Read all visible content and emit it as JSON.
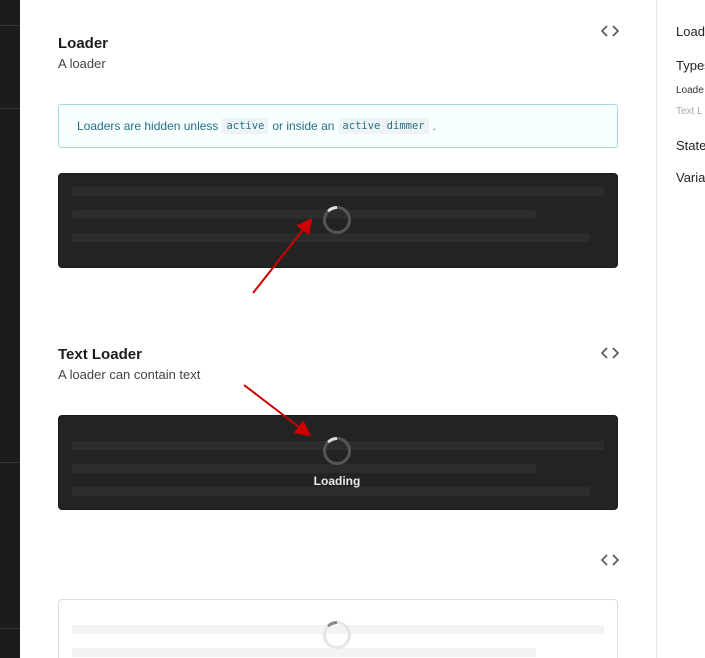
{
  "sections": [
    {
      "title": "Loader",
      "description": "A loader",
      "info": {
        "text_before": "Loaders are hidden unless",
        "code1": "active",
        "text_middle": "or inside an",
        "code2": "active dimmer",
        "text_after": "."
      }
    },
    {
      "title": "Text Loader",
      "description": "A loader can contain text",
      "loader_text": "Loading"
    }
  ],
  "right_nav": {
    "title": "Load",
    "types": "Types",
    "sub1": "Loade",
    "sub2": "Text L",
    "states": "State",
    "variations": "Varia"
  },
  "icons": {
    "code_toggle": "code-brackets-icon",
    "spinner": "spinner-icon",
    "annotation": "red-arrow"
  },
  "colors": {
    "info_bg": "#f8ffff",
    "info_border": "#a9d5de",
    "info_text": "#276f86",
    "dimmer_bg": "#232323",
    "arrow": "#cc0000"
  }
}
